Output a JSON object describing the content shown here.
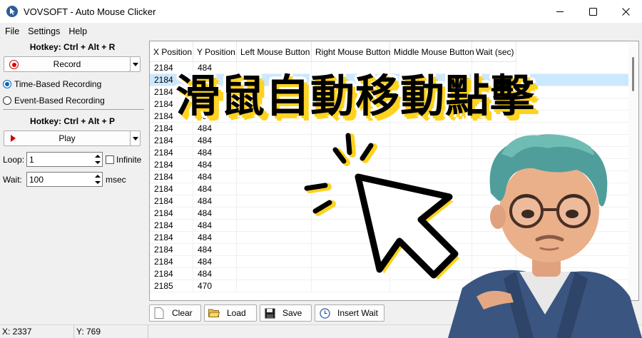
{
  "window": {
    "title": "VOVSOFT - Auto Mouse Clicker"
  },
  "menu": [
    "File",
    "Settings",
    "Help"
  ],
  "record": {
    "hotkey": "Hotkey: Ctrl + Alt + R",
    "button": "Record",
    "options": [
      "Time-Based Recording",
      "Event-Based Recording"
    ],
    "selected": "Time-Based Recording"
  },
  "play": {
    "hotkey": "Hotkey: Ctrl + Alt + P",
    "button": "Play",
    "loop_label": "Loop:",
    "loop_value": "1",
    "infinite_label": "Infinite",
    "infinite_checked": false,
    "wait_label": "Wait:",
    "wait_value": "100",
    "wait_unit": "msec"
  },
  "table": {
    "columns": [
      "X Position",
      "Y Position",
      "Left Mouse Button",
      "Right Mouse Button",
      "Middle Mouse Button",
      "Wait (sec)"
    ],
    "rows": [
      [
        "2184",
        "484"
      ],
      [
        "2184",
        "484"
      ],
      [
        "2184",
        "484"
      ],
      [
        "2184",
        "484"
      ],
      [
        "2184",
        "484"
      ],
      [
        "2184",
        "484"
      ],
      [
        "2184",
        "484"
      ],
      [
        "2184",
        "484"
      ],
      [
        "2184",
        "484"
      ],
      [
        "2184",
        "484"
      ],
      [
        "2184",
        "484"
      ],
      [
        "2184",
        "484"
      ],
      [
        "2184",
        "484"
      ],
      [
        "2184",
        "484"
      ],
      [
        "2184",
        "484"
      ],
      [
        "2184",
        "484"
      ],
      [
        "2184",
        "484"
      ],
      [
        "2184",
        "484"
      ],
      [
        "2185",
        "470"
      ]
    ],
    "selected_row": 1
  },
  "toolbar": {
    "clear": "Clear",
    "load": "Load",
    "save": "Save",
    "insert_wait": "Insert Wait"
  },
  "status": {
    "x": "X: 2337",
    "y": "Y: 769"
  },
  "overlay": {
    "title": "滑鼠自動移動點擊"
  },
  "colors": {
    "accent": "#0067c0",
    "selection": "#cce8ff",
    "highlight": "#ffd21e",
    "record_red": "#d00000"
  }
}
